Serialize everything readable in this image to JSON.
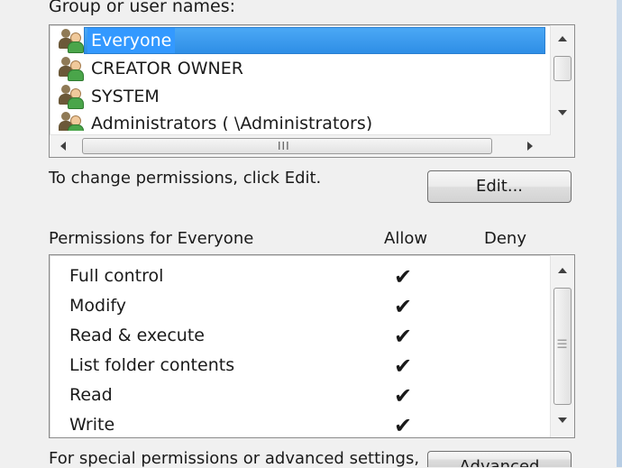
{
  "groups": {
    "label": "Group or user names:",
    "items": [
      {
        "name": "Everyone",
        "selected": true
      },
      {
        "name": "CREATOR OWNER",
        "selected": false
      },
      {
        "name": "SYSTEM",
        "selected": false
      },
      {
        "name": "Administrators (           \\Administrators)",
        "selected": false
      }
    ],
    "hscroll_grip": "III"
  },
  "change_hint": "To change permissions, click Edit.",
  "edit_button": "Edit...",
  "permissions": {
    "header": "Permissions for Everyone",
    "allow_label": "Allow",
    "deny_label": "Deny",
    "check_glyph": "✔",
    "rows": [
      {
        "name": "Full control",
        "allow": true,
        "deny": false
      },
      {
        "name": "Modify",
        "allow": true,
        "deny": false
      },
      {
        "name": "Read & execute",
        "allow": true,
        "deny": false
      },
      {
        "name": "List folder contents",
        "allow": true,
        "deny": false
      },
      {
        "name": "Read",
        "allow": true,
        "deny": false
      },
      {
        "name": "Write",
        "allow": true,
        "deny": false
      }
    ]
  },
  "special_hint": "For special permissions or advanced settings,",
  "advanced_button": "Advanced",
  "colors": {
    "selection": "#3399ff",
    "background": "#f0f0f0"
  }
}
